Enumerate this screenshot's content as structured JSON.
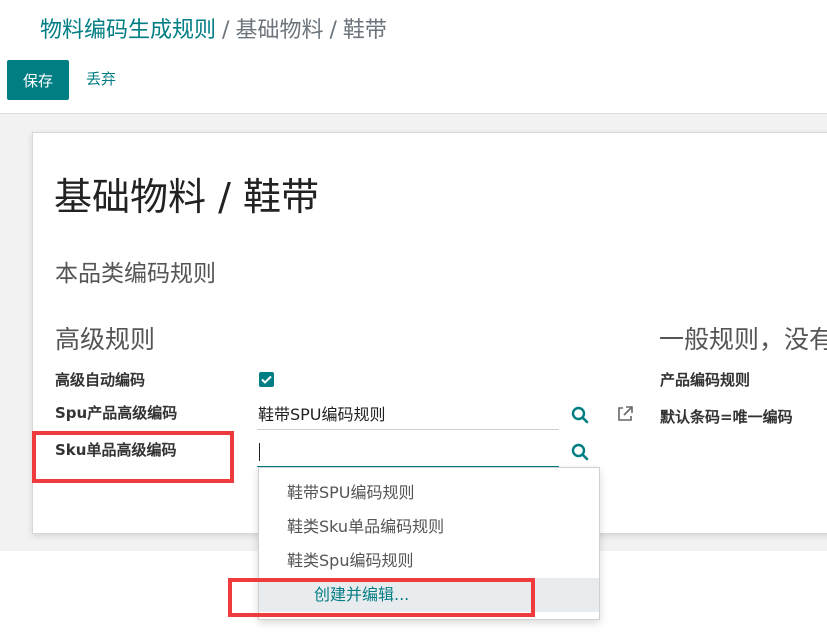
{
  "breadcrumb": {
    "root": "物料编码生成规则",
    "separator": "/",
    "middle": "基础物料",
    "current": "鞋带"
  },
  "toolbar": {
    "save_label": "保存",
    "discard_label": "丢弃"
  },
  "record": {
    "title": "基础物料 / 鞋带",
    "section_title": "本品类编码规则"
  },
  "advanced": {
    "group_title": "高级规则",
    "auto_code_label": "高级自动编码",
    "auto_code_checked": true,
    "spu_label": "Spu产品高级编码",
    "spu_value": "鞋带SPU编码规则",
    "sku_label": "Sku单品高级编码",
    "sku_value": ""
  },
  "general": {
    "group_title": "一般规则，没有",
    "product_rule_label": "产品编码规则",
    "default_barcode_label": "默认条码=唯一编码"
  },
  "dropdown": {
    "options": [
      "鞋带SPU编码规则",
      "鞋类Sku单品编码规则",
      "鞋类Spu编码规则"
    ],
    "create_label": "创建并编辑..."
  },
  "colors": {
    "accent": "#017e84",
    "highlight": "#ef3b3b"
  }
}
